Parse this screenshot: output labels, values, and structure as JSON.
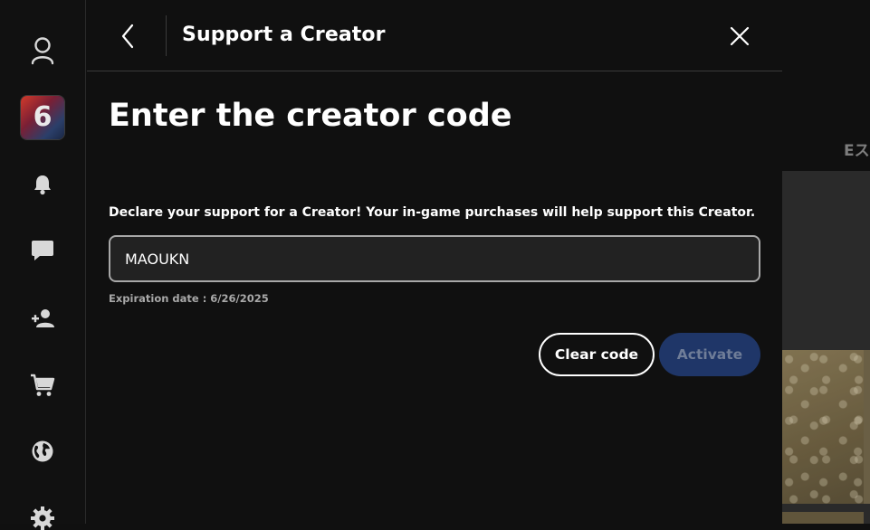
{
  "header": {
    "title": "Support a Creator"
  },
  "main": {
    "heading": "Enter the creator code",
    "description": "Declare your support for a Creator! Your in-game purchases will help support this Creator.",
    "code_value": "MAOUKN",
    "expiration": "Expiration date : 6/26/2025",
    "clear_label": "Clear code",
    "activate_label": "Activate",
    "activate_enabled": false
  },
  "rail": {
    "game_tile_text": "6",
    "icons": [
      "profile-icon",
      "game-tile",
      "bell-icon",
      "chat-icon",
      "friends-icon",
      "cart-icon",
      "globe-icon",
      "gear-icon"
    ]
  },
  "background": {
    "partial_text": "Eス"
  },
  "colors": {
    "background": "#101010",
    "rail": "#111111",
    "input_bg": "#222222",
    "input_border": "#a8a8a8",
    "activate_bg": "#1f3668",
    "activate_text": "#6f7d98",
    "muted_text": "#a8a8a8"
  }
}
